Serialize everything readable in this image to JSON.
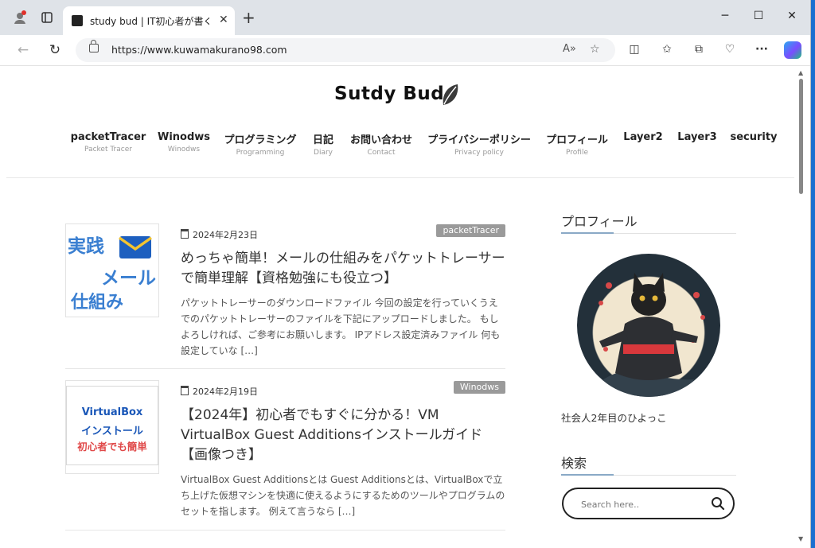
{
  "browser": {
    "tab_title": "study bud | IT初心者が書くブログ",
    "url": "https://www.kuwamakurano98.com"
  },
  "site": {
    "logo_text": "Sutdy Bud",
    "nav": [
      {
        "label": "packetTracer",
        "sub": "Packet Tracer"
      },
      {
        "label": "Winodws",
        "sub": "Winodws"
      },
      {
        "label": "プログラミング",
        "sub": "Programming"
      },
      {
        "label": "日記",
        "sub": "Diary"
      },
      {
        "label": "お問い合わせ",
        "sub": "Contact"
      },
      {
        "label": "プライバシーポリシー",
        "sub": "Privacy policy"
      },
      {
        "label": "プロフィール",
        "sub": "Profile"
      },
      {
        "label": "Layer2",
        "sub": ""
      },
      {
        "label": "Layer3",
        "sub": ""
      },
      {
        "label": "security",
        "sub": ""
      }
    ]
  },
  "posts": [
    {
      "date": "2024年2月23日",
      "category": "packetTracer",
      "title": "めっちゃ簡単！メールの仕組みをパケットトレーサーで簡単理解【資格勉強にも役立つ】",
      "excerpt": "パケットトレーサーのダウンロードファイル 今回の設定を行っていくうえでのパケットトレーサーのファイルを下記にアップロードしました。 もしよろしければ、ご参考にお願いします。 IPアドレス設定済みファイル 何も設定していな […]",
      "thumb": {
        "line1": "実践",
        "line2": "メール",
        "line3": "仕組み"
      }
    },
    {
      "date": "2024年2月19日",
      "category": "Winodws",
      "title": "【2024年】初心者でもすぐに分かる！VM VirtualBox Guest Additionsインストールガイド【画像つき】",
      "excerpt": "VirtualBox Guest Additionsとは Guest Additionsとは、VirtualBoxで立ち上げた仮想マシンを快適に使えるようにするためのツールやプログラムのセットを指します。 例えて言うなら […]",
      "thumb": {
        "line1": "VirtualBox",
        "line2": "インストール",
        "line3": "初心者でも簡単"
      }
    }
  ],
  "sidebar": {
    "profile_heading": "プロフィール",
    "profile_text": "社会人2年目のひよっこ",
    "search_heading": "検索",
    "search_placeholder": "Search here.."
  },
  "colors": {
    "thumb1_text": "#3a7fd1",
    "thumb2_blue": "#1a57b8",
    "thumb2_red": "#e04848",
    "category_bg": "#9a9a9a"
  }
}
